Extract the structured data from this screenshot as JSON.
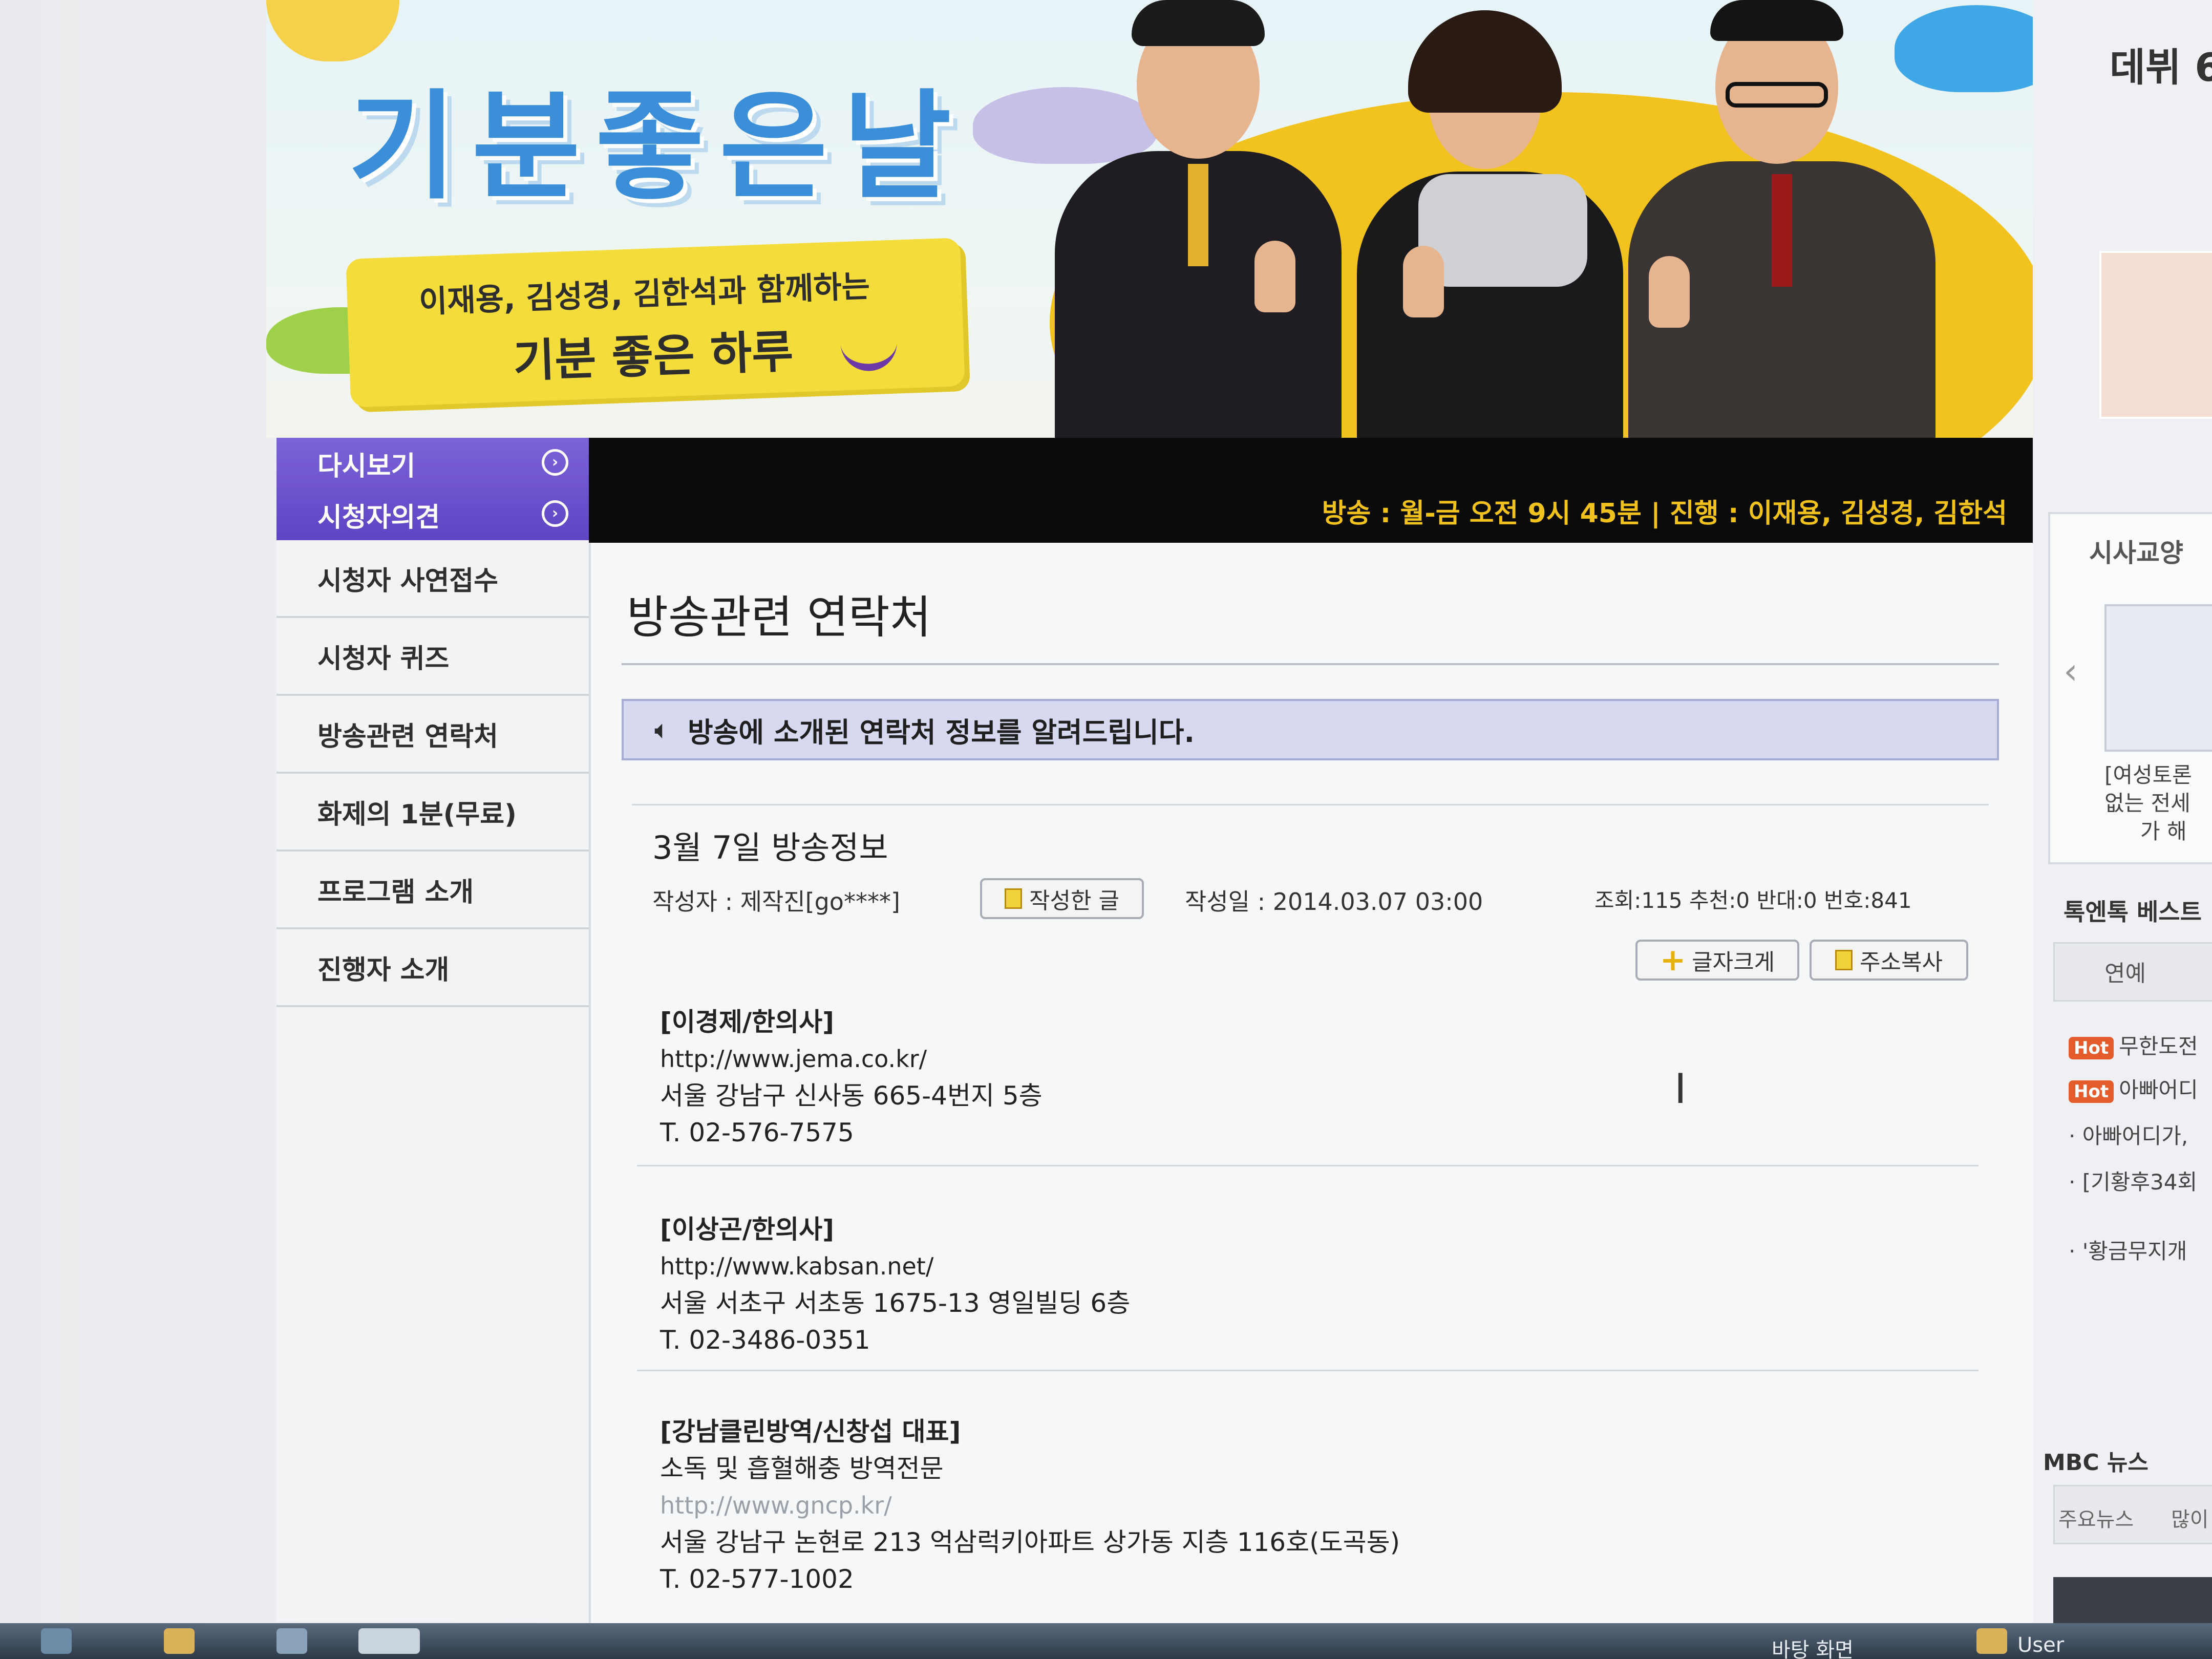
{
  "banner": {
    "logo": "기분좋은날",
    "tagline_line1": "이재용, 김성경, 김한석과 함께하는",
    "tagline_line2": "기분 좋은 하루"
  },
  "left_menu": {
    "purple_items": [
      {
        "label": "다시보기"
      },
      {
        "label": "시청자의견"
      }
    ],
    "items": [
      {
        "label": "시청자 사연접수"
      },
      {
        "label": "시청자 퀴즈"
      },
      {
        "label": "방송관련 연락처"
      },
      {
        "label": "화제의 1분(무료)"
      },
      {
        "label": "프로그램 소개"
      },
      {
        "label": "진행자 소개"
      }
    ]
  },
  "broadcast_info": "방송 : 월-금 오전 9시 45분 | 진행 : 이재용, 김성경, 김한석",
  "page_title": "방송관련 연락처",
  "notice": "방송에 소개된 연락처 정보를 알려드립니다.",
  "post": {
    "title": "3월 7일 방송정보",
    "author": "작성자 : 제작진[go****]",
    "written_btn": "작성한 글",
    "date": "작성일 : 2014.03.07 03:00",
    "stats": "조회:115 추천:0 반대:0 번호:841",
    "font_btn": "글자크게",
    "copy_btn": "주소복사"
  },
  "entries": [
    {
      "name": "[이경제/한의사]",
      "url": "http://www.jema.co.kr/",
      "address": "서울 강남구 신사동 665-4번지 5층",
      "phone": "T. 02-576-7575"
    },
    {
      "name": "[이상곤/한의사]",
      "url": "http://www.kabsan.net/",
      "address": "서울 서초구 서초동 1675-13 영일빌딩 6층",
      "phone": "T. 02-3486-0351"
    },
    {
      "name": "[강남클린방역/신창섭 대표]",
      "desc": "소독 및 흡혈해충 방역전문",
      "url": "http://www.gncp.kr/",
      "address": "서울 강남구 논현로 213 억삼럭키아파트 상가동 지층 116호(도곡동)",
      "phone": "T. 02-577-1002"
    }
  ],
  "right_sidebar": {
    "debut": "데뷔 6",
    "section1": "시사교양",
    "caption1": "[여성토론",
    "caption2": "없는 전세",
    "caption3": "가 해",
    "section2": "톡엔톡 베스트",
    "tab": "연예",
    "hot_label": "Hot",
    "items": [
      "무한도전",
      "아빠어디",
      "아빠어디가,",
      "[기황후34회",
      "'황금무지개"
    ],
    "news_title": "MBC 뉴스",
    "news_tab1": "주요뉴스",
    "news_tab2": "많이"
  },
  "taskbar": {
    "desktop": "바탕 화면",
    "user": "User"
  },
  "colors": {
    "menu_purple": "#6a4fcf",
    "accent_yellow": "#f1c21e",
    "notice_bg": "#d6d9ef"
  }
}
